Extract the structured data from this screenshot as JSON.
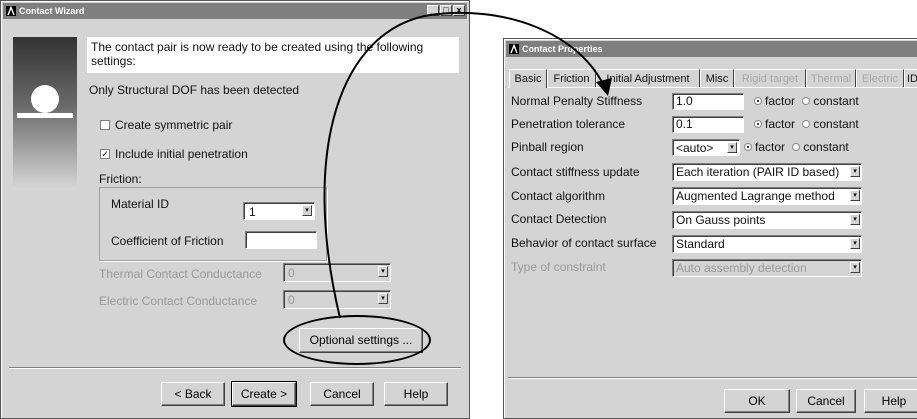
{
  "wizard": {
    "title": "Contact Wizard",
    "window_controls": [
      "_",
      "□",
      "x"
    ],
    "message": "The contact pair is now ready to be created using the following settings:",
    "dof_text": "Only Structural DOF has been detected",
    "symmetric_label": "Create symmetric pair",
    "symmetric_checked": false,
    "penetration_label": "Include initial penetration",
    "penetration_checked": true,
    "friction_heading": "Friction:",
    "material_label": "Material ID",
    "material_value": "1",
    "coef_label": "Coefficient of Friction",
    "coef_value": "",
    "thermal_label": "Thermal Contact Conductance",
    "thermal_value": "0",
    "electric_label": "Electric Contact Conductance",
    "electric_value": "0",
    "optional_label": "Optional settings ...",
    "back_label": "< Back",
    "create_label": "Create >",
    "cancel_label": "Cancel",
    "help_label": "Help"
  },
  "props": {
    "title": "Contact Properties",
    "tabs": [
      {
        "label": "Basic",
        "enabled": true
      },
      {
        "label": "Friction",
        "enabled": true
      },
      {
        "label": "Initial Adjustment",
        "enabled": true
      },
      {
        "label": "Misc",
        "enabled": true
      },
      {
        "label": "Rigid target",
        "enabled": false
      },
      {
        "label": "Thermal",
        "enabled": false
      },
      {
        "label": "Electric",
        "enabled": false
      },
      {
        "label": "ID",
        "enabled": true
      }
    ],
    "rows": {
      "normal_penalty": {
        "label": "Normal Penalty Stiffness",
        "value": "1.0",
        "opt1": "factor",
        "opt2": "constant"
      },
      "penetration": {
        "label": "Penetration tolerance",
        "value": "0.1",
        "opt1": "factor",
        "opt2": "constant"
      },
      "pinball": {
        "label": "Pinball region",
        "value": "<auto>",
        "opt1": "factor",
        "opt2": "constant"
      },
      "stiffness_update": {
        "label": "Contact stiffness update",
        "value": "Each iteration (PAIR ID based)"
      },
      "algorithm": {
        "label": "Contact algorithm",
        "value": "Augmented Lagrange method"
      },
      "detection": {
        "label": "Contact Detection",
        "value": "On Gauss points"
      },
      "behavior": {
        "label": "Behavior of contact surface",
        "value": "Standard"
      },
      "constraint": {
        "label": "Type of constraint",
        "value": "Auto assembly detection"
      }
    },
    "ok_label": "OK",
    "cancel_label": "Cancel",
    "help_label": "Help"
  },
  "colors": {
    "dialog_bg": "#d4d4d4",
    "titlebar": "#7f7f7f",
    "disabled_text": "#999999"
  }
}
